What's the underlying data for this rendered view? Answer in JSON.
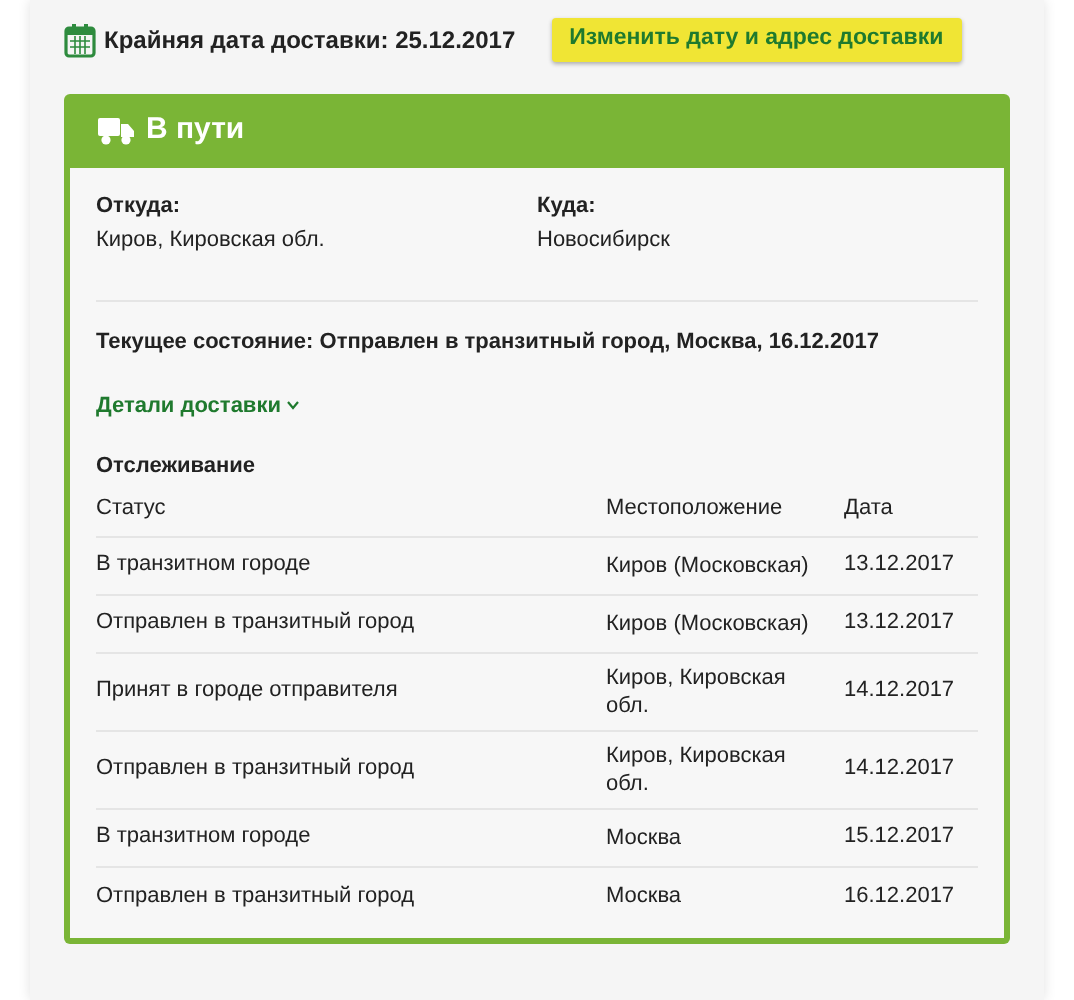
{
  "deadline": {
    "label": "Крайняя дата доставки: 25.12.2017",
    "button": "Изменить дату и адрес доставки"
  },
  "card": {
    "title": "В пути",
    "from": {
      "label": "Откуда:",
      "value": "Киров, Кировская обл."
    },
    "to": {
      "label": "Куда:",
      "value": "Новосибирск"
    },
    "current_state": "Текущее состояние: Отправлен в транзитный город, Москва, 16.12.2017",
    "details_link": {
      "label": "Детали доставки",
      "expanded": false
    },
    "tracking_title": "Отслеживание",
    "table": {
      "columns": [
        "Статус",
        "Местоположение",
        "Дата"
      ],
      "rows": [
        [
          "В транзитном городе",
          "Киров (Московская)",
          "13.12.2017"
        ],
        [
          "Отправлен в транзитный город",
          "Киров (Московская)",
          "13.12.2017"
        ],
        [
          "Принят в городе отправителя",
          "Киров, Кировская обл.",
          "14.12.2017"
        ],
        [
          "Отправлен в транзитный город",
          "Киров, Кировская обл.",
          "14.12.2017"
        ],
        [
          "В транзитном городе",
          "Москва",
          "15.12.2017"
        ],
        [
          "Отправлен в транзитный город",
          "Москва",
          "16.12.2017"
        ]
      ]
    }
  }
}
